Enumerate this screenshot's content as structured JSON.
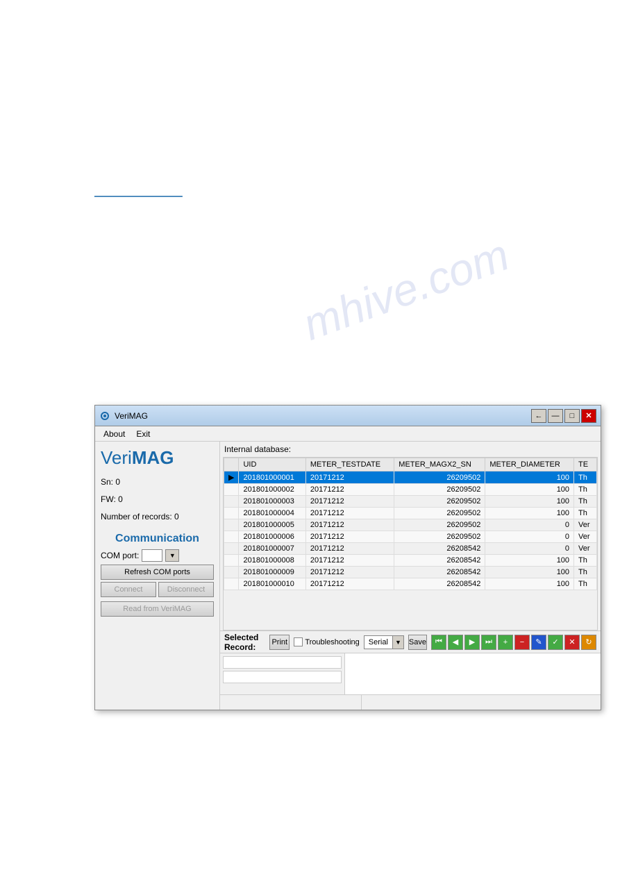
{
  "watermark": {
    "text": "mhive.com"
  },
  "link": {
    "text": "___________________"
  },
  "window": {
    "title": "VeriMAG",
    "title_icon": "⚙",
    "controls": {
      "back": "←",
      "minimize": "—",
      "maximize": "□",
      "close": "✕"
    }
  },
  "menu": {
    "items": [
      "About",
      "Exit"
    ]
  },
  "logo": {
    "veri": "Veri",
    "mag": "MAG"
  },
  "info": {
    "sn": "Sn: 0",
    "fw": "FW: 0",
    "records": "Number of records: 0"
  },
  "communication": {
    "title": "Communication",
    "com_port_label": "COM port:",
    "com_port_value": "",
    "refresh_btn": "Refresh COM ports",
    "connect_btn": "Connect",
    "disconnect_btn": "Disconnect",
    "read_btn": "Read from VeriMAG"
  },
  "database": {
    "label": "Internal database:",
    "columns": [
      "UID",
      "METER_TESTDATE",
      "METER_MAGX2_SN",
      "METER_DIAMETER",
      "TE"
    ],
    "rows": [
      {
        "selected": true,
        "uid": "201801000001",
        "date": "20171212",
        "sn": "26209502",
        "diameter": "100",
        "te": "Th"
      },
      {
        "selected": false,
        "uid": "201801000002",
        "date": "20171212",
        "sn": "26209502",
        "diameter": "100",
        "te": "Th"
      },
      {
        "selected": false,
        "uid": "201801000003",
        "date": "20171212",
        "sn": "26209502",
        "diameter": "100",
        "te": "Th"
      },
      {
        "selected": false,
        "uid": "201801000004",
        "date": "20171212",
        "sn": "26209502",
        "diameter": "100",
        "te": "Th"
      },
      {
        "selected": false,
        "uid": "201801000005",
        "date": "20171212",
        "sn": "26209502",
        "diameter": "0",
        "te": "Ver"
      },
      {
        "selected": false,
        "uid": "201801000006",
        "date": "20171212",
        "sn": "26209502",
        "diameter": "0",
        "te": "Ver"
      },
      {
        "selected": false,
        "uid": "201801000007",
        "date": "20171212",
        "sn": "26208542",
        "diameter": "0",
        "te": "Ver"
      },
      {
        "selected": false,
        "uid": "201801000008",
        "date": "20171212",
        "sn": "26208542",
        "diameter": "100",
        "te": "Th"
      },
      {
        "selected": false,
        "uid": "201801000009",
        "date": "20171212",
        "sn": "26208542",
        "diameter": "100",
        "te": "Th"
      },
      {
        "selected": false,
        "uid": "201801000010",
        "date": "20171212",
        "sn": "26208542",
        "diameter": "100",
        "te": "Th"
      }
    ]
  },
  "bottom_bar": {
    "selected_record_label": "Selected Record:",
    "print_btn": "Print",
    "troubleshoot_label": "Troubleshooting",
    "serial_label": "Serial",
    "save_btn": "Save"
  },
  "toolbar_icons": [
    {
      "name": "nav-first",
      "symbol": "⏮",
      "color": "green"
    },
    {
      "name": "nav-prev",
      "symbol": "◀",
      "color": "green"
    },
    {
      "name": "nav-next",
      "symbol": "▶",
      "color": "green"
    },
    {
      "name": "nav-last",
      "symbol": "⏭",
      "color": "green"
    },
    {
      "name": "add",
      "symbol": "+",
      "color": "green"
    },
    {
      "name": "remove",
      "symbol": "−",
      "color": "red"
    },
    {
      "name": "edit",
      "symbol": "✎",
      "color": "blue"
    },
    {
      "name": "confirm",
      "symbol": "✓",
      "color": "green"
    },
    {
      "name": "cancel-edit",
      "symbol": "✕",
      "color": "red"
    },
    {
      "name": "refresh",
      "symbol": "↻",
      "color": "orange"
    }
  ]
}
